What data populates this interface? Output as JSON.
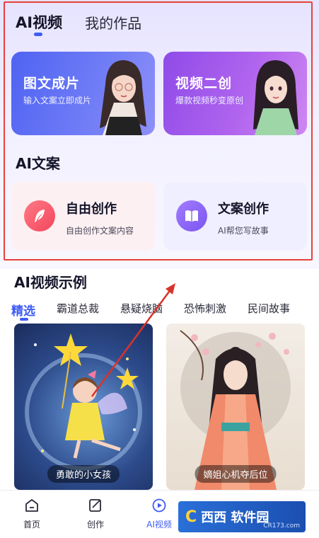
{
  "top_tabs": {
    "active": "AI视频",
    "other": "我的作品"
  },
  "feature_cards": [
    {
      "title": "图文成片",
      "subtitle": "输入文案立即成片"
    },
    {
      "title": "视频二创",
      "subtitle": "爆款视频秒变原创"
    }
  ],
  "copy_section": {
    "title": "AI文案"
  },
  "copy_cards": [
    {
      "title": "自由创作",
      "subtitle": "自由创作文案内容",
      "icon": "feather-icon"
    },
    {
      "title": "文案创作",
      "subtitle": "AI帮您写故事",
      "icon": "book-icon"
    }
  ],
  "examples_section": {
    "title": "AI视频示例"
  },
  "categories": [
    "精选",
    "霸道总裁",
    "悬疑烧脑",
    "恐怖刺激",
    "民间故事"
  ],
  "examples": [
    {
      "caption": "勇敢的小女孩"
    },
    {
      "caption": "嫡姐心机夺后位"
    }
  ],
  "bottom_nav": [
    {
      "label": "首页",
      "icon": "home-icon"
    },
    {
      "label": "创作",
      "icon": "edit-icon"
    },
    {
      "label": "AI视频",
      "icon": "play-circle-icon"
    }
  ],
  "colors": {
    "accent": "#3f5cf5",
    "highlight_box": "#e8403c",
    "arrow": "#d8332a"
  }
}
